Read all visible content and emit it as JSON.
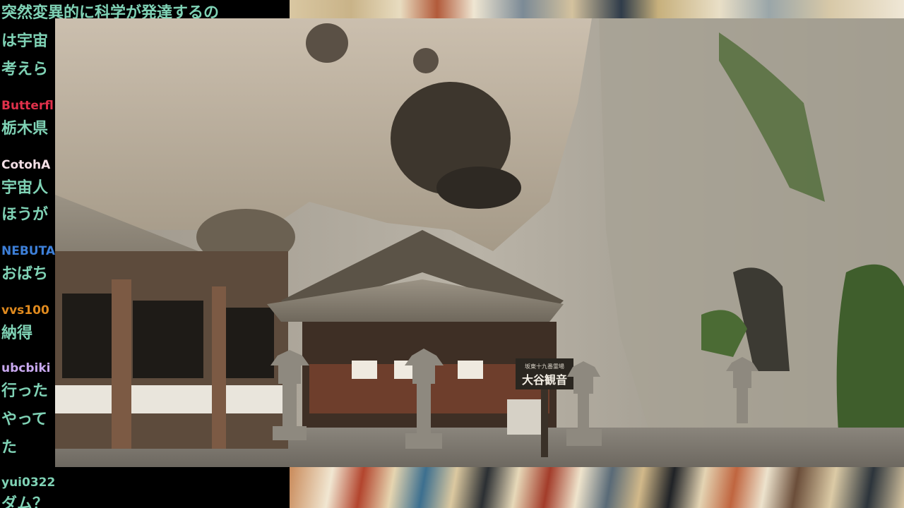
{
  "chat": {
    "lines": [
      {
        "kind": "text",
        "text": "突然変異的に科学が発達するの"
      },
      {
        "kind": "text",
        "text": "は宇宙"
      },
      {
        "kind": "text",
        "text": "考えら"
      },
      {
        "kind": "user",
        "text": "Butterfl",
        "color": "#e0314b"
      },
      {
        "kind": "text",
        "text": "栃木県"
      },
      {
        "kind": "user",
        "text": "CotohA",
        "color": "#f4dfe6"
      },
      {
        "kind": "text",
        "text": "宇宙人"
      },
      {
        "kind": "text",
        "text": "ほうが"
      },
      {
        "kind": "user",
        "text": "NEBUTA",
        "color": "#3d7fd8"
      },
      {
        "kind": "text",
        "text": "おばち"
      },
      {
        "kind": "user",
        "text": "vvs100",
        "color": "#e08a1e"
      },
      {
        "kind": "text",
        "text": "納得"
      },
      {
        "kind": "user",
        "text": "ubcbiki",
        "color": "#c8a8ef"
      },
      {
        "kind": "text",
        "text": "行った"
      },
      {
        "kind": "text",
        "text": "やって"
      },
      {
        "kind": "text",
        "text": "た"
      },
      {
        "kind": "user",
        "text": "yui0322",
        "color": "#7fd2b5"
      },
      {
        "kind": "text",
        "text": "ダム？"
      }
    ]
  },
  "photo": {
    "sign_text": "大谷観音",
    "sign_small": "坂東十九番霊場"
  },
  "colors": {
    "chat_bg": "#000000",
    "chat_text": "#7fd2b5"
  }
}
